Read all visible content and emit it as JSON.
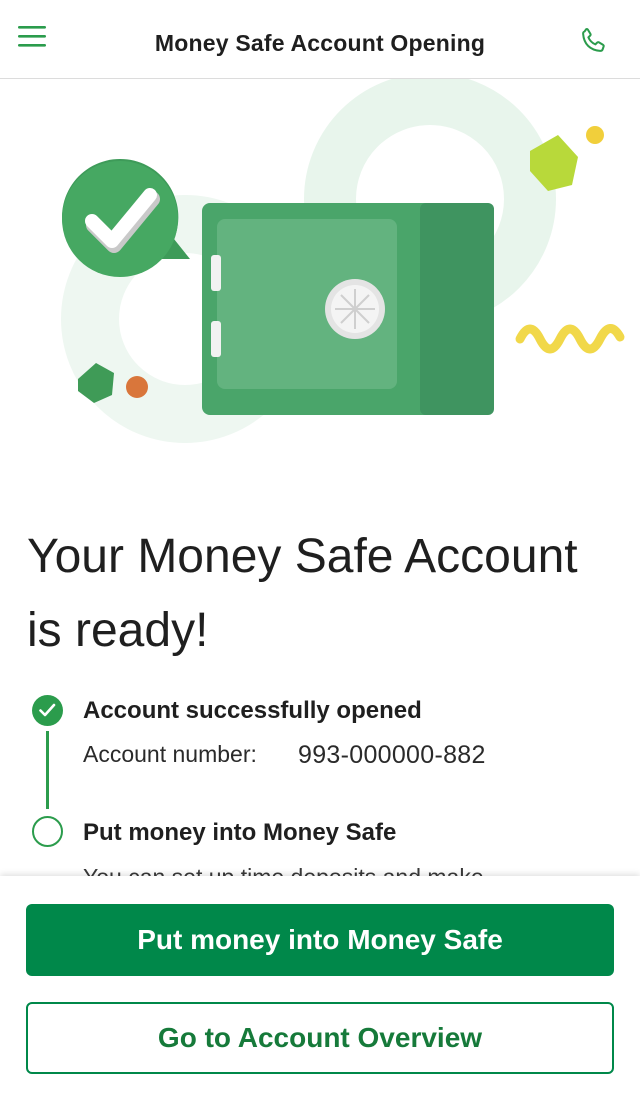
{
  "header": {
    "title": "Money Safe Account Opening",
    "menu_icon": "hamburger-menu-icon",
    "phone_icon": "phone-icon"
  },
  "hero": {
    "illustration": "green-safe-illustration",
    "badge_icon": "checkmark-speech-bubble-icon"
  },
  "headline": "Your Money Safe Account is ready!",
  "steps": [
    {
      "status": "done",
      "title": "Account successfully opened",
      "account_label": "Account number:",
      "account_number": "993-000000-882"
    },
    {
      "status": "pending",
      "title": "Put money into Money Safe",
      "description": "You can set up time deposits and make"
    }
  ],
  "actions": {
    "primary_label": "Put money into Money Safe",
    "secondary_label": "Go to Account Overview"
  },
  "colors": {
    "brand_green": "#00884a",
    "step_green": "#2b9c4c",
    "safe_green": "#4caf6e"
  }
}
